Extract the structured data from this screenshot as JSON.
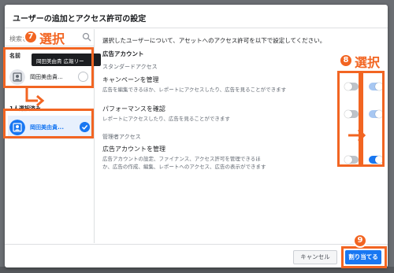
{
  "dialog": {
    "title": "ユーザーの追加とアクセス許可の設定"
  },
  "left": {
    "search_placeholder": "検索さ",
    "section_name": "名前",
    "person_name": "岡田美由貴...",
    "tooltip": "岡田美由貴 広報リー",
    "selected_section": "1人選択済み",
    "selected_person_name": "岡田美由貴..."
  },
  "right": {
    "description": "選択したユーザーについて、アセットへのアクセス許可を以下で設定してください。",
    "ad_account_heading": "広告アカウント",
    "standard_access": "スタンダードアクセス",
    "permissions": [
      {
        "title": "キャンペーンを管理",
        "description": "広告を編集できるほか、レポートにアクセスしたり、広告を見ることができます",
        "toggle_state": "off",
        "selected_state": "on"
      },
      {
        "title": "パフォーマンスを確認",
        "description": "レポートにアクセスしたり、広告を見ることができます",
        "toggle_state": "off",
        "selected_state": "on"
      }
    ],
    "admin_access": "管理者アクセス",
    "admin_permission": {
      "title": "広告アカウントを管理",
      "description": "広告アカウントの設定、ファイナンス、アクセス許可を管理できるほか、広告の作成、編集、レポートへのアクセス、広告の表示ができます",
      "toggle_state": "off",
      "selected_state": "on"
    }
  },
  "footer": {
    "cancel_label": "キャンセル",
    "assign_label": "割り当てる"
  },
  "annotations": {
    "step7_number": "7",
    "step7_text": "選択",
    "step8_number": "8",
    "step8_text": "選択",
    "step9_number": "9"
  },
  "colors": {
    "accent": "#1877f2",
    "annotation": "#f26522"
  }
}
